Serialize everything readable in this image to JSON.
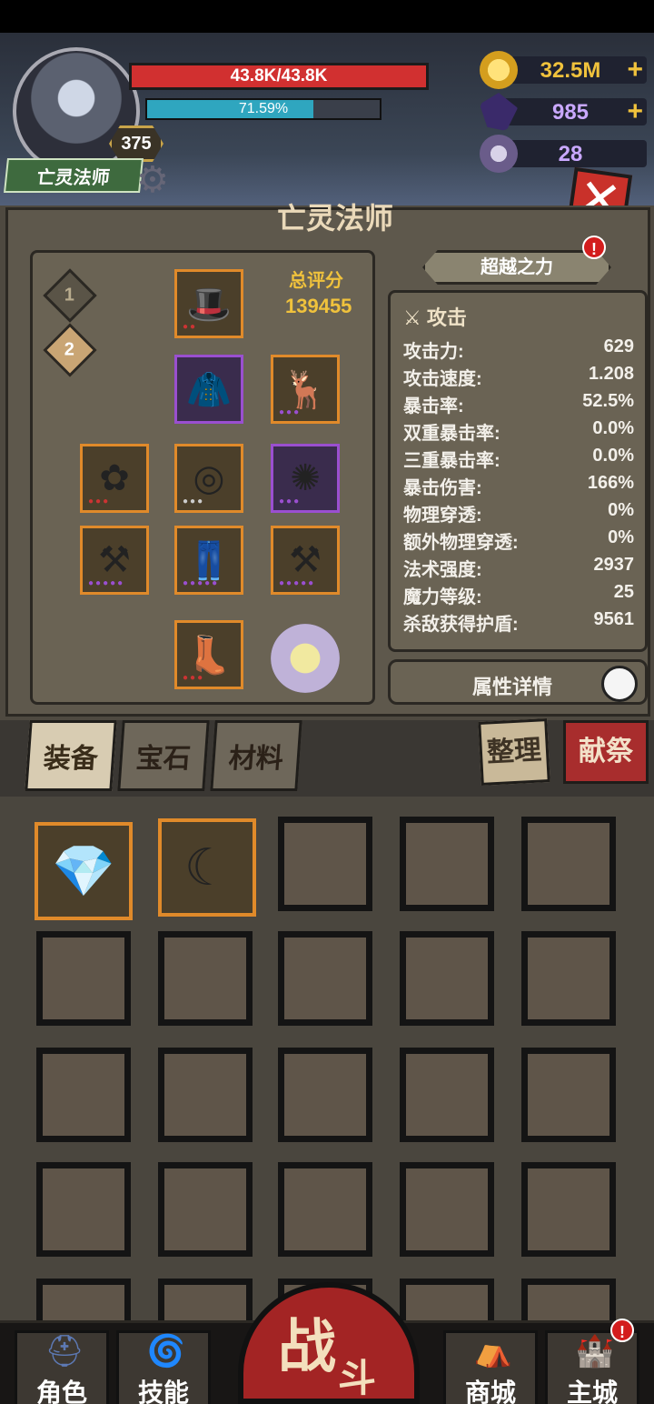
{
  "header": {
    "character_name": "亡灵法师",
    "level": "375",
    "hp_text": "43.8K/43.8K",
    "exp_text": "71.59%",
    "exp_fraction": 0.7159
  },
  "currencies": [
    {
      "name": "gold",
      "value": "32.5M",
      "icon": "gold-coin-icon",
      "color": "#f0c23c"
    },
    {
      "name": "crystal",
      "value": "985",
      "icon": "purple-crystal-icon",
      "color": "#c9a8ff"
    },
    {
      "name": "ram",
      "value": "28",
      "icon": "ram-skull-icon",
      "color": "#c9a8ff"
    }
  ],
  "panel": {
    "title": "亡灵法师",
    "score_label": "总评分",
    "score_value": "139455",
    "set_tabs": [
      "1",
      "2"
    ],
    "transcend_label": "超越之力",
    "transcend_alert": "!",
    "detail_label": "属性详情"
  },
  "stats": {
    "section": "攻击",
    "rows": [
      {
        "label": "攻击力:",
        "value": "629"
      },
      {
        "label": "攻击速度:",
        "value": "1.208"
      },
      {
        "label": "暴击率:",
        "value": "52.5%"
      },
      {
        "label": "双重暴击率:",
        "value": "0.0%"
      },
      {
        "label": "三重暴击率:",
        "value": "0.0%"
      },
      {
        "label": "暴击伤害:",
        "value": "166%"
      },
      {
        "label": "物理穿透:",
        "value": "0%"
      },
      {
        "label": "额外物理穿透:",
        "value": "0%"
      },
      {
        "label": "法术强度:",
        "value": "2937"
      },
      {
        "label": "魔力等级:",
        "value": "25"
      },
      {
        "label": "杀敌获得护盾:",
        "value": "9561"
      }
    ]
  },
  "tabs": {
    "equipment": "装备",
    "gems": "宝石",
    "materials": "材料",
    "sort": "整理",
    "sacrifice": "献祭"
  },
  "nav": {
    "character": "角色",
    "skills": "技能",
    "battle_1": "战",
    "battle_2": "斗",
    "shop": "商城",
    "main_city": "主城",
    "main_city_alert": "!"
  }
}
